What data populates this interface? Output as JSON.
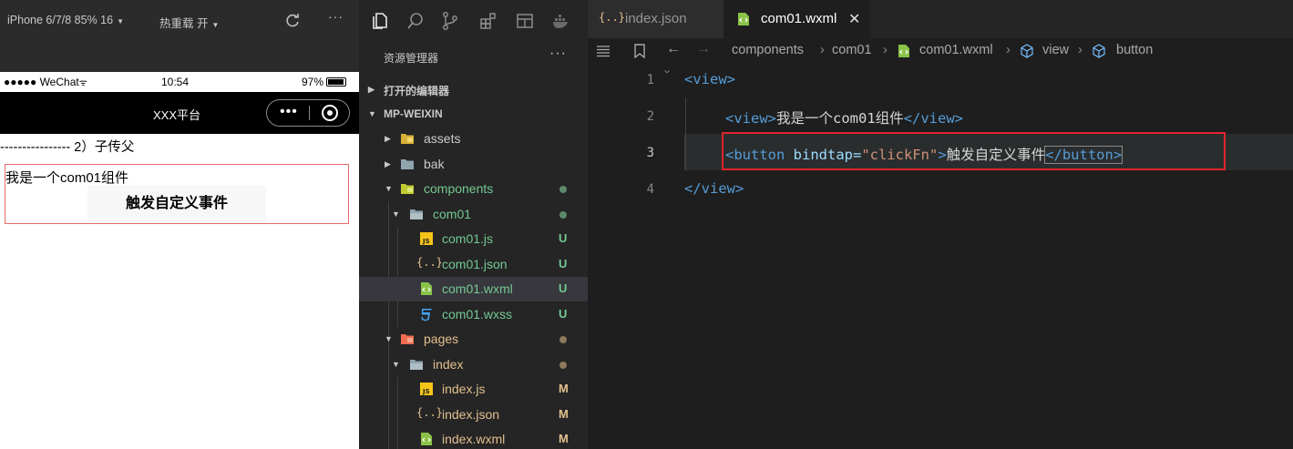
{
  "simulator": {
    "toolbar": {
      "device_label": "iPhone 6/7/8 85% 16",
      "hot_reload_label": "热重载 开",
      "more_label": "···"
    },
    "status_bar": {
      "carrier": "●●●●● WeChat",
      "time": "10:54",
      "battery_text": "97%",
      "battery_level": 0.97
    },
    "nav_bar": {
      "title": "XXX平台",
      "capsule_dots": "•••"
    },
    "page": {
      "divider_text": "---------------- 2）子传父",
      "component_text": "我是一个com01组件",
      "button_label": "触发自定义事件"
    }
  },
  "explorer": {
    "header_title": "资源管理器",
    "header_more": "···",
    "open_editors_label": "打开的编辑器",
    "workspace_label": "MP-WEIXIN",
    "tree": [
      {
        "name": "assets",
        "status": ""
      },
      {
        "name": "bak",
        "status": ""
      },
      {
        "name": "components",
        "status": "●"
      },
      {
        "name": "com01",
        "status": "●"
      },
      {
        "name": "com01.js",
        "status": "U"
      },
      {
        "name": "com01.json",
        "status": "U"
      },
      {
        "name": "com01.wxml",
        "status": "U"
      },
      {
        "name": "com01.wxss",
        "status": "U"
      },
      {
        "name": "pages",
        "status": "●"
      },
      {
        "name": "index",
        "status": "●"
      },
      {
        "name": "index.js",
        "status": "M"
      },
      {
        "name": "index.json",
        "status": "M"
      },
      {
        "name": "index.wxml",
        "status": "M"
      }
    ],
    "colors": {
      "untracked": "#73c991",
      "modified": "#e2c08d",
      "selected_bg": "#37373d"
    }
  },
  "editor": {
    "tabs": [
      {
        "label": "index.json",
        "icon": "{..}",
        "active": false
      },
      {
        "label": "com01.wxml",
        "active": true,
        "close": "✕"
      }
    ],
    "breadcrumb": {
      "components": "components",
      "com01": "com01",
      "file": "com01.wxml",
      "view": "view",
      "button": "button"
    },
    "line_numbers": [
      "1",
      "2",
      "3",
      "4"
    ],
    "code": {
      "l1_open": "<view>",
      "l2_open": "<view>",
      "l2_text": "我是一个com01组件",
      "l2_close": "</view>",
      "l3_tag_open": "<button ",
      "l3_attr": "bindtap=",
      "l3_value": "\"clickFn\"",
      "l3_gt": ">",
      "l3_text": "触发自定义事件",
      "l3_close": "</button>",
      "l4_close": "</view>"
    },
    "highlight_color": "#e0242b"
  }
}
